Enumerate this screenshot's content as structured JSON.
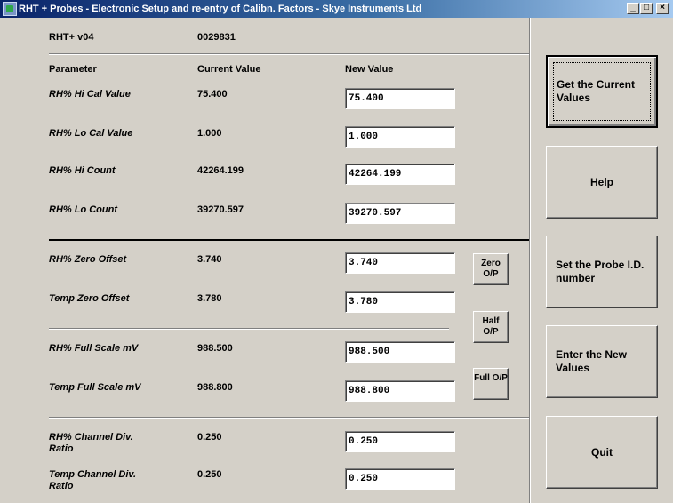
{
  "window": {
    "title": "RHT + Probes - Electronic Setup and re-entry of Calibn. Factors - Skye Instruments Ltd",
    "controls": [
      "_",
      "□",
      "×"
    ]
  },
  "header": {
    "model": "RHT+ v04",
    "serial": "0029831"
  },
  "columns": {
    "parameter": "Parameter",
    "current": "Current Value",
    "new": "New Value"
  },
  "rows": [
    {
      "label": "RH% Hi Cal Value",
      "current": "75.400",
      "new": "75.400"
    },
    {
      "label": "RH% Lo Cal Value",
      "current": "1.000",
      "new": "1.000"
    },
    {
      "label": "RH% Hi Count",
      "current": "42264.199",
      "new": "42264.199"
    },
    {
      "label": "RH% Lo Count",
      "current": "39270.597",
      "new": "39270.597"
    },
    {
      "label": "RH% Zero Offset",
      "current": "3.740",
      "new": "3.740"
    },
    {
      "label": "Temp Zero Offset",
      "current": "3.780",
      "new": "3.780"
    },
    {
      "label": "RH% Full Scale mV",
      "current": "988.500",
      "new": "988.500"
    },
    {
      "label": "Temp Full Scale mV",
      "current": "988.800",
      "new": "988.800"
    },
    {
      "label": "RH% Channel Div. Ratio",
      "current": "0.250",
      "new": "0.250"
    },
    {
      "label": "Temp Channel Div. Ratio",
      "current": "0.250",
      "new": "0.250"
    }
  ],
  "small_buttons": {
    "zero": "Zero O/P",
    "half": "Half O/P",
    "full": "Full O/P"
  },
  "buttons": {
    "get_current": "Get the Current Values",
    "help": "Help",
    "set_probe_id": "Set the Probe I.D. number",
    "enter_new": "Enter the New Values",
    "quit": "Quit"
  }
}
